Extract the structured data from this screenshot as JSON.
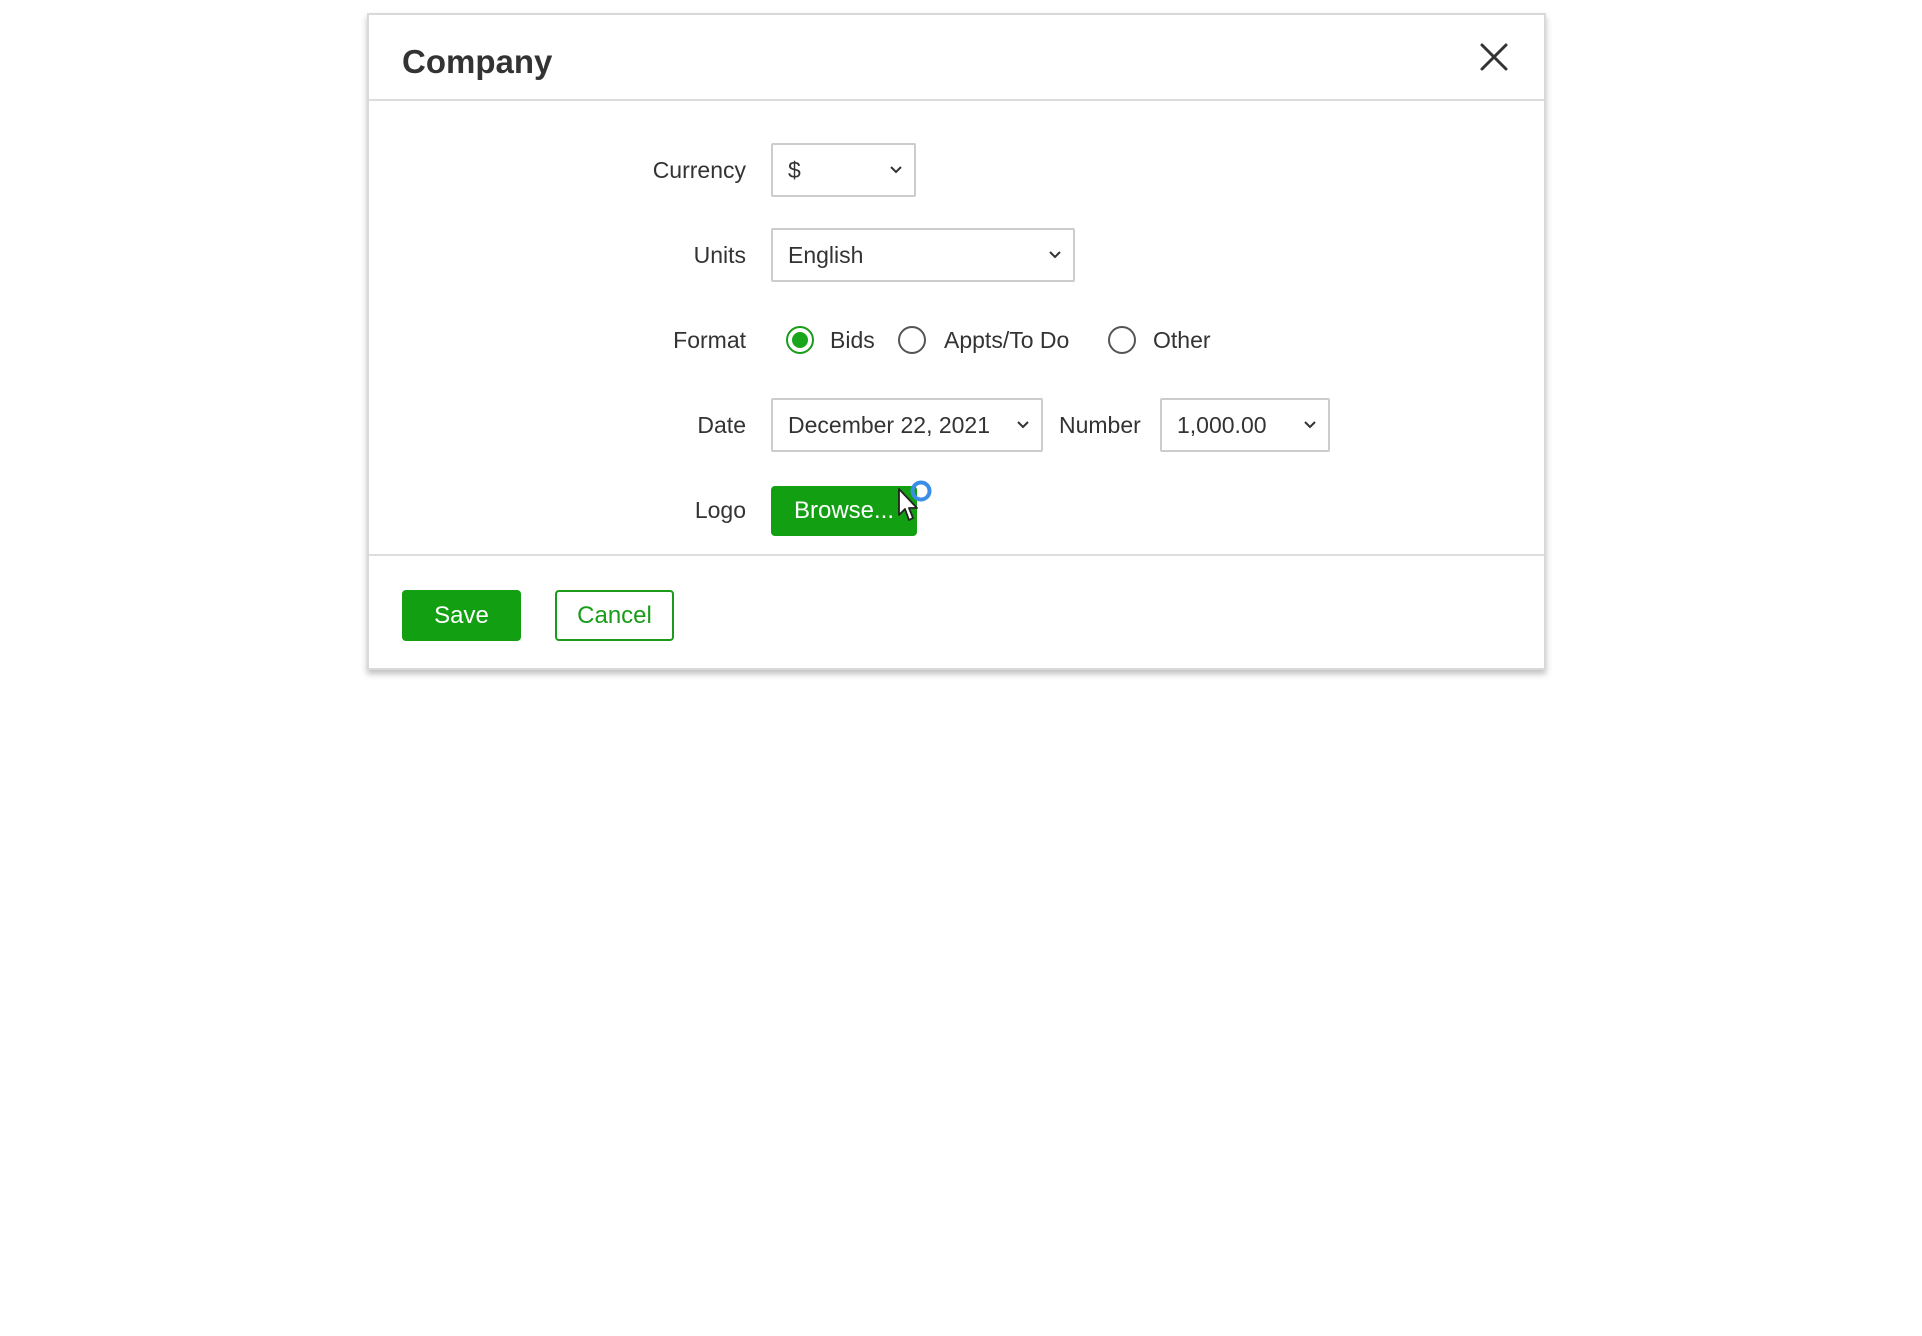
{
  "dialog": {
    "title": "Company",
    "close_icon": "close-icon"
  },
  "form": {
    "currency": {
      "label": "Currency",
      "value": "$"
    },
    "units": {
      "label": "Units",
      "value": "English"
    },
    "format": {
      "label": "Format",
      "options": [
        {
          "label": "Bids",
          "checked": true
        },
        {
          "label": "Appts/To Do",
          "checked": false
        },
        {
          "label": "Other",
          "checked": false
        }
      ]
    },
    "date": {
      "label": "Date",
      "value": "December 22, 2021"
    },
    "number": {
      "label": "Number",
      "value": "1,000.00"
    },
    "logo": {
      "label": "Logo",
      "browse_label": "Browse..."
    }
  },
  "footer": {
    "save_label": "Save",
    "cancel_label": "Cancel"
  },
  "colors": {
    "accent": "#12a012",
    "border": "#cccccc",
    "text": "#333333",
    "spinner": "#3a8ee6"
  }
}
